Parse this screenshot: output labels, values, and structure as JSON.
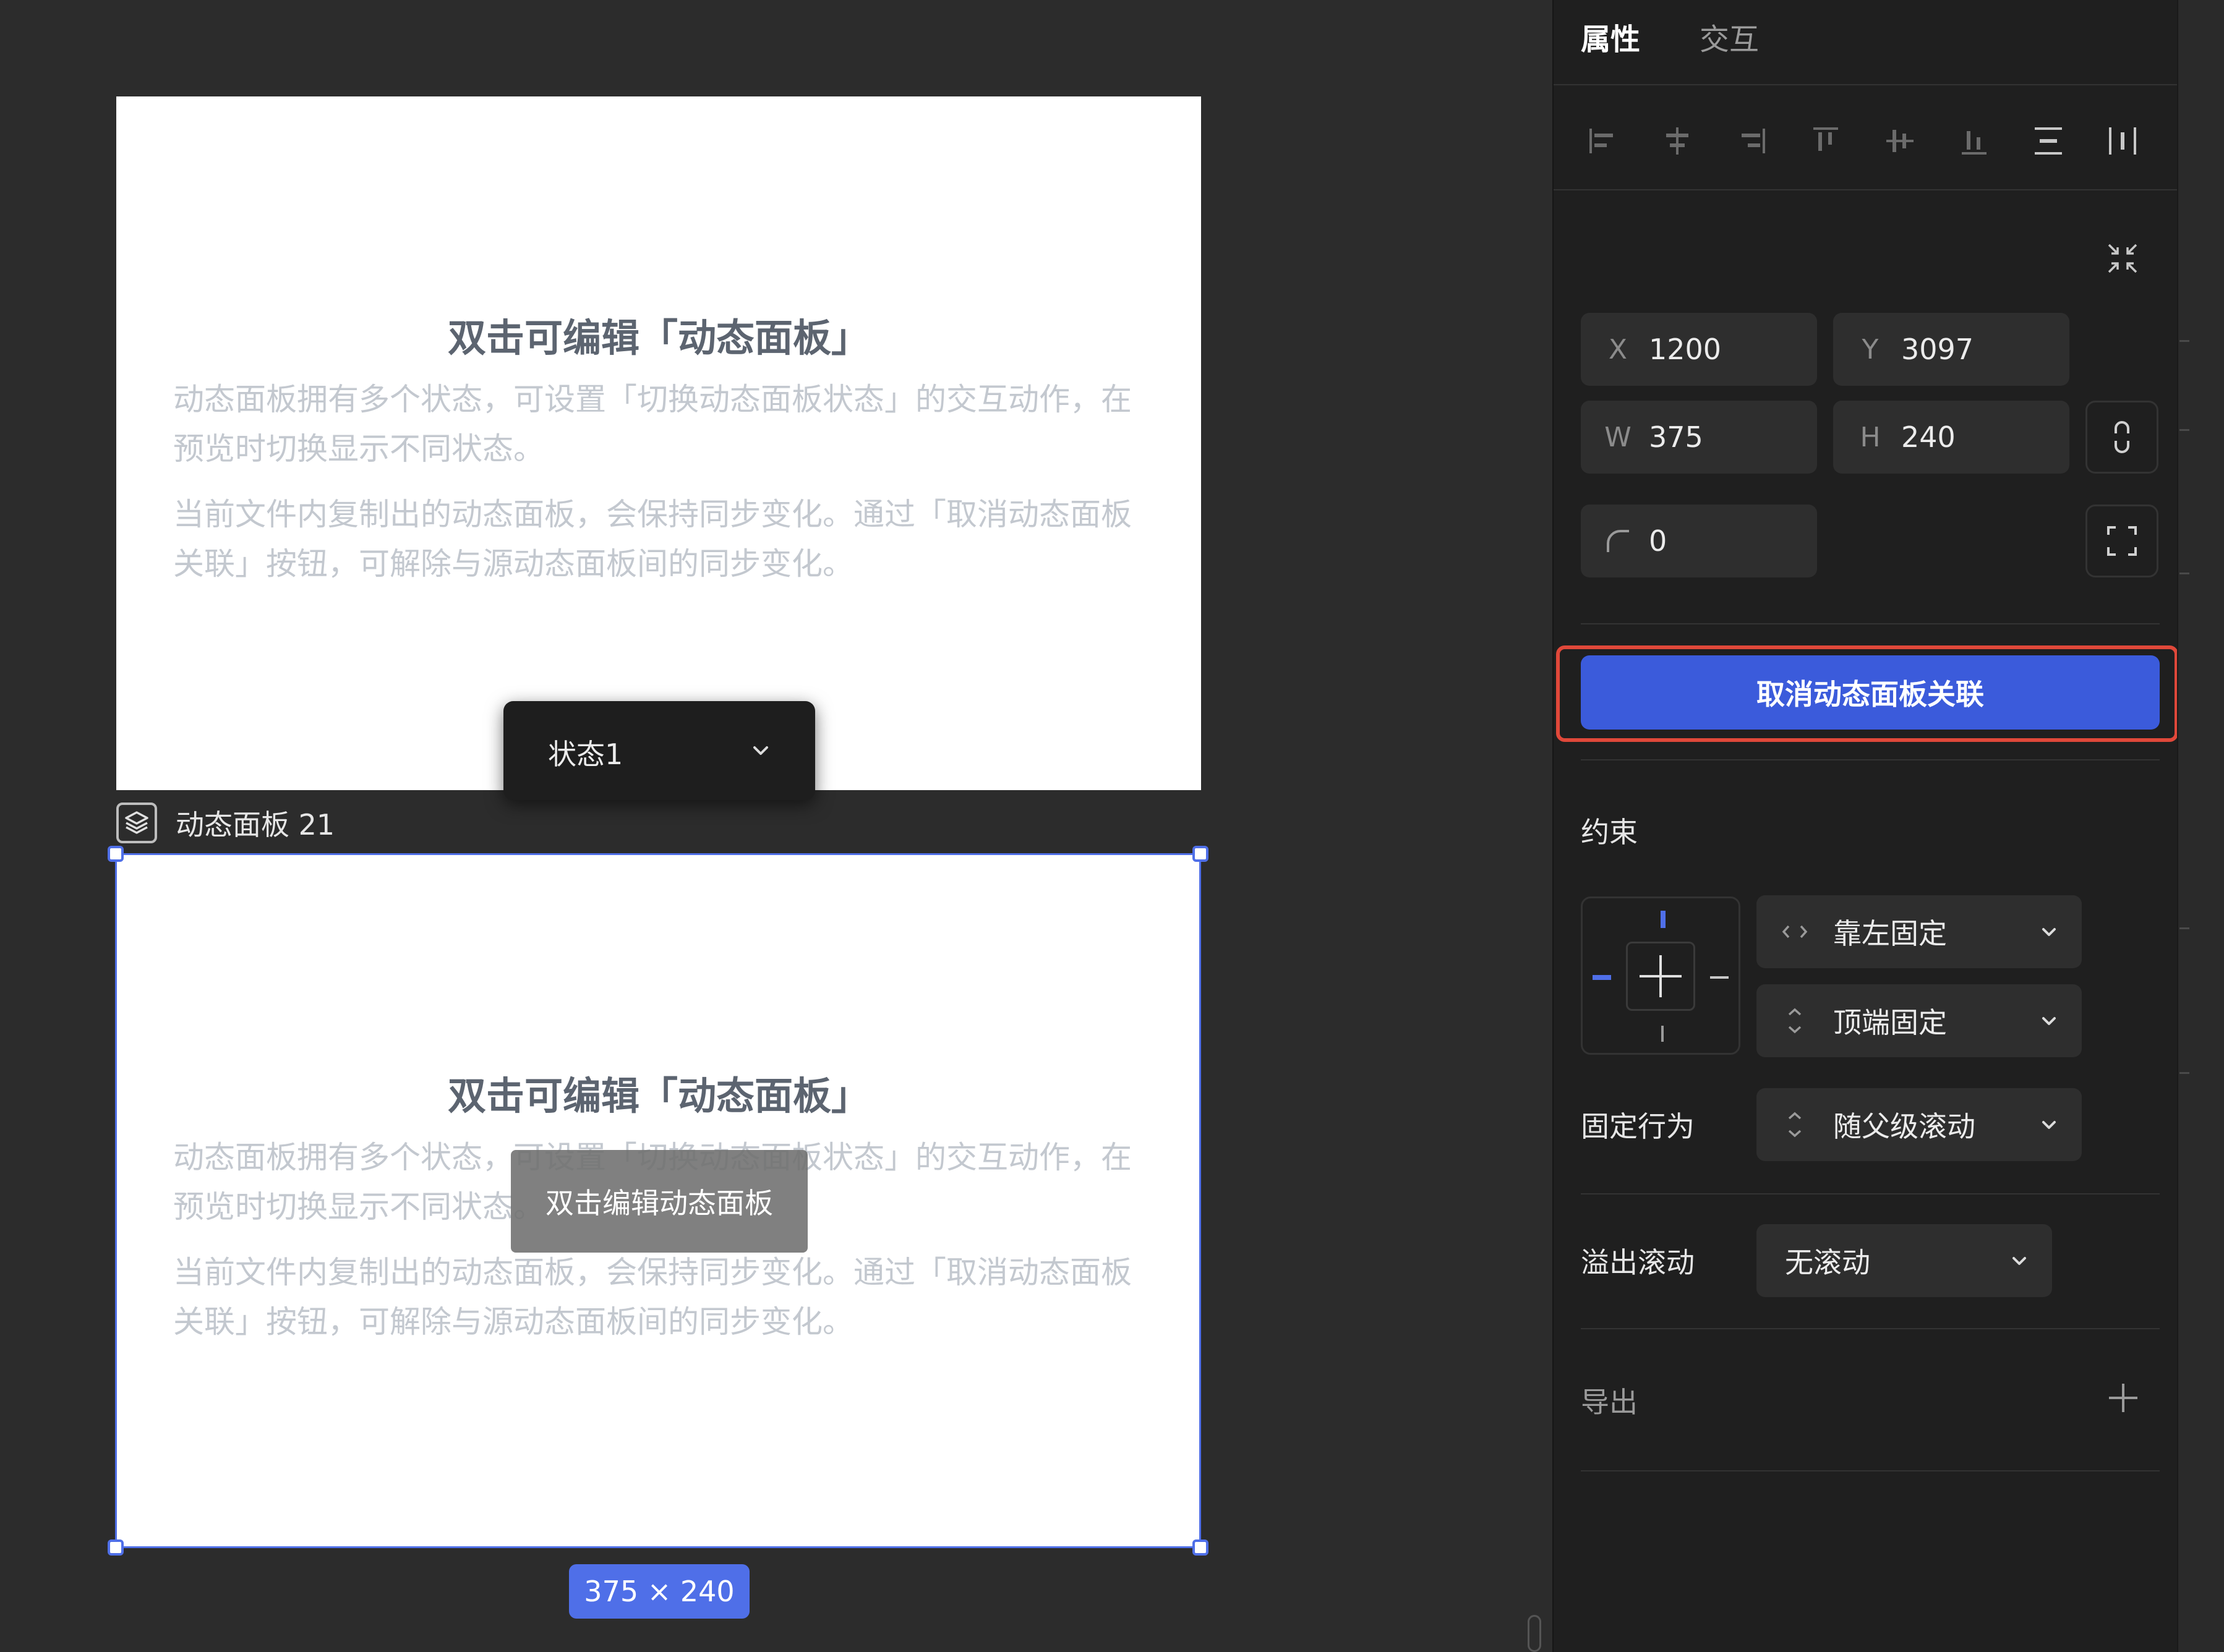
{
  "canvas": {
    "card_title": "双击可编辑「动态面板」",
    "card_paragraph_1": "动态面板拥有多个状态，可设置「切换动态面板状态」的交互动作，在预览时切换显示不同状态。",
    "card_paragraph_2": "当前文件内复制出的动态面板，会保持同步变化。通过「取消动态面板关联」按钮，可解除与源动态面板间的同步变化。",
    "state_select": "状态1",
    "layer_name": "动态面板 21",
    "hover_tip": "双击编辑动态面板",
    "size_badge": "375 × 240"
  },
  "panel": {
    "tabs": [
      {
        "label": "属性",
        "active": true
      },
      {
        "label": "交互",
        "active": false
      }
    ],
    "align_icons": [
      "align-left-icon",
      "align-center-horizontal-icon",
      "align-right-icon",
      "align-top-icon",
      "align-center-vertical-icon",
      "align-bottom-icon",
      "distribute-vertical-icon",
      "distribute-horizontal-icon"
    ],
    "x_label": "X",
    "x_value": "1200",
    "y_label": "Y",
    "y_value": "3097",
    "w_label": "W",
    "w_value": "375",
    "h_label": "H",
    "h_value": "240",
    "radius_value": "0",
    "unlink_button": "取消动态面板关联",
    "constraints_title": "约束",
    "horizontal_constraint": "靠左固定",
    "vertical_constraint": "顶端固定",
    "fixed_behavior_label": "固定行为",
    "fixed_behavior_value": "随父级滚动",
    "overflow_label": "溢出滚动",
    "overflow_value": "无滚动",
    "export_label": "导出"
  },
  "colors": {
    "accent": "#3b5bdb",
    "selection": "#4f6fe8",
    "highlight_border": "#e0483a"
  }
}
